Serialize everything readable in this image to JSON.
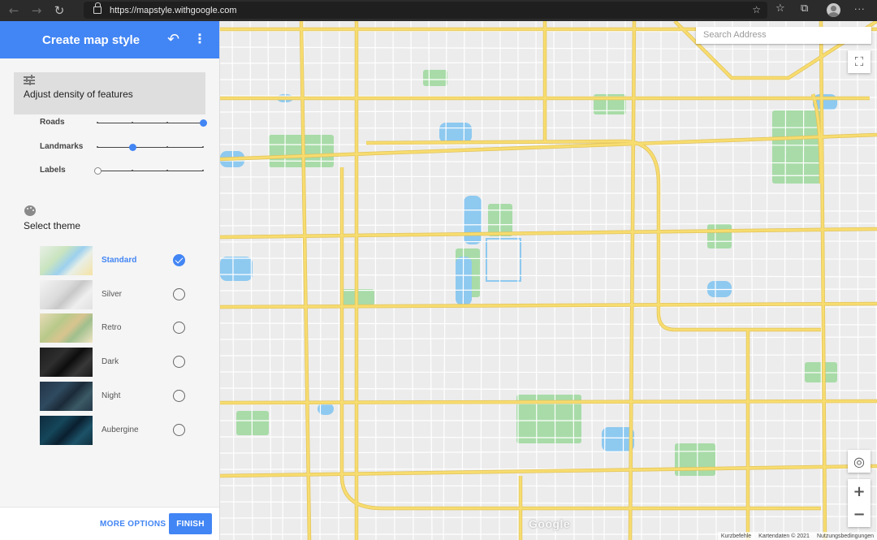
{
  "browser": {
    "url": "https://mapstyle.withgoogle.com",
    "menu_glyph": "···"
  },
  "panel": {
    "title": "Create map style",
    "density": {
      "title": "Adjust density of features",
      "sliders": [
        {
          "label": "Roads",
          "level": 1.0
        },
        {
          "label": "Landmarks",
          "level": 0.33
        },
        {
          "label": "Labels",
          "level": 0.0
        }
      ]
    },
    "theme": {
      "title": "Select theme",
      "options": [
        {
          "name": "Standard",
          "selected": true
        },
        {
          "name": "Silver",
          "selected": false
        },
        {
          "name": "Retro",
          "selected": false
        },
        {
          "name": "Dark",
          "selected": false
        },
        {
          "name": "Night",
          "selected": false
        },
        {
          "name": "Aubergine",
          "selected": false
        }
      ]
    },
    "footer": {
      "more_options": "MORE OPTIONS",
      "finish": "FINISH"
    }
  },
  "map": {
    "search_placeholder": "Search Address",
    "logo": "Google",
    "attribution": {
      "shortcuts": "Kurzbefehle",
      "data": "Kartendaten © 2021",
      "terms": "Nutzungsbedingungen"
    }
  },
  "colors": {
    "accent": "#4285f4",
    "road_major": "#f7dc6f",
    "park": "#a8dba8",
    "water": "#8ec9f0",
    "map_bg": "#ececec"
  }
}
